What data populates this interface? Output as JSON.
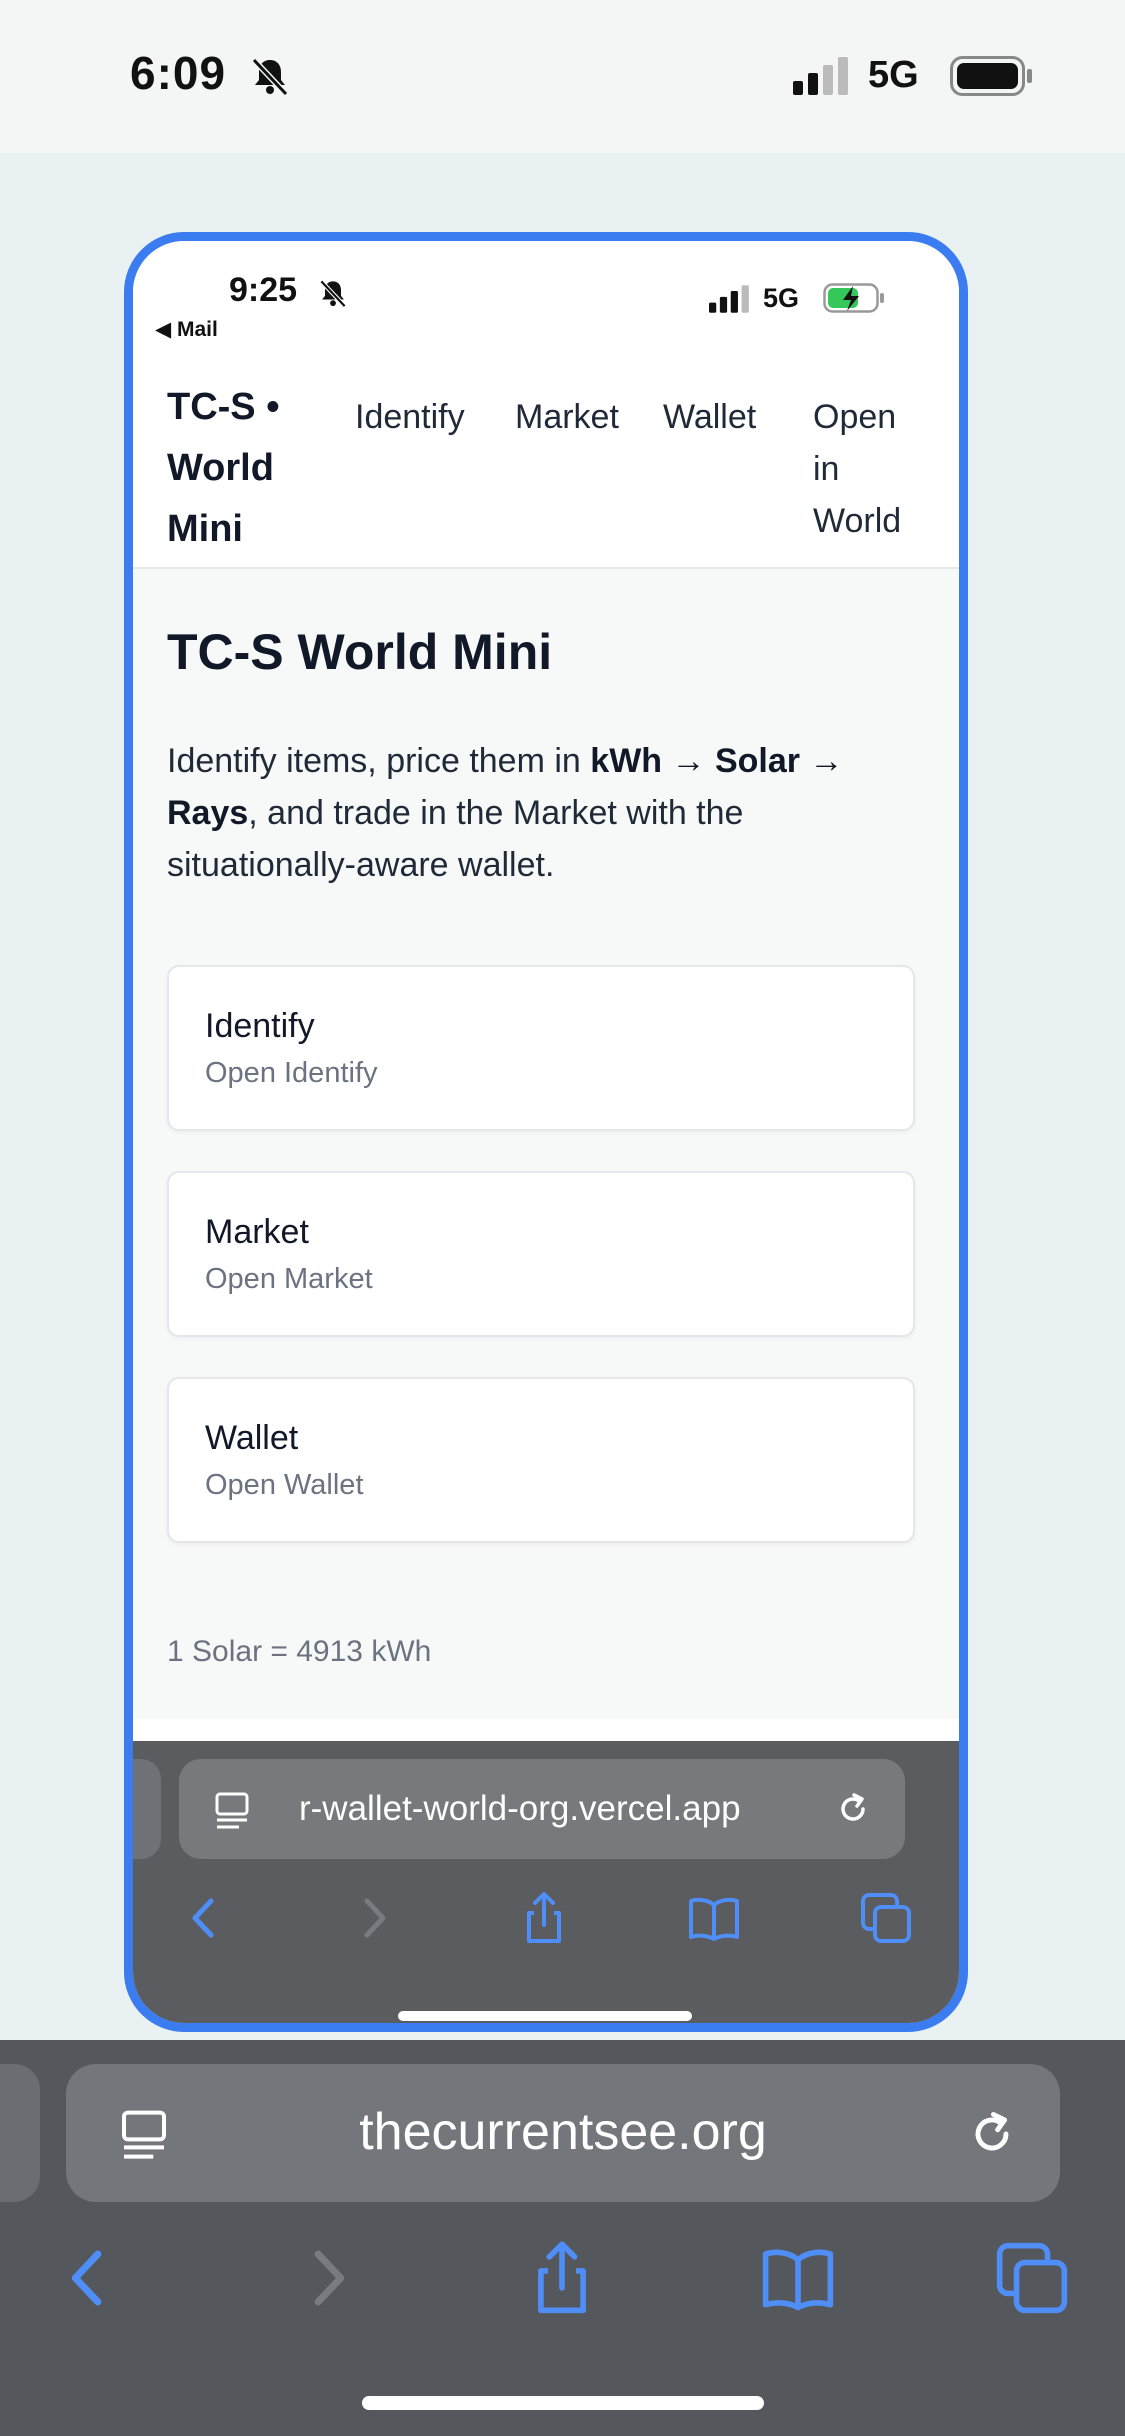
{
  "outer_status": {
    "time": "6:09",
    "network": "5G"
  },
  "inner_status": {
    "time": "9:25",
    "back_label": "◀ Mail",
    "network": "5G"
  },
  "nav": {
    "brand": "TC-S • World Mini",
    "links": [
      "Identify",
      "Market",
      "Wallet",
      "Open in World"
    ]
  },
  "main": {
    "title": "TC-S World Mini",
    "intro_prefix": "Identify items, price them in ",
    "intro_bold": "kWh → Solar → Rays",
    "intro_suffix": ", and trade in the Market with the situationally-aware wallet.",
    "cards": [
      {
        "title": "Identify",
        "subtitle": "Open Identify"
      },
      {
        "title": "Market",
        "subtitle": "Open Market"
      },
      {
        "title": "Wallet",
        "subtitle": "Open Wallet"
      }
    ],
    "rate_text": "1 Solar = 4913 kWh"
  },
  "inner_browser": {
    "url": "r-wallet-world-org.vercel.app"
  },
  "outer_browser": {
    "url": "thecurrentsee.org"
  },
  "colors": {
    "accent": "#3b7df0",
    "browser_icon": "#4f8ef7",
    "page_bg": "#eaf1f2",
    "toolbar_bg": "#54575b"
  },
  "icons": [
    "bell-slash-icon",
    "signal-icon",
    "battery-icon",
    "battery-charging-icon",
    "reader-icon",
    "reload-icon",
    "back-arrow-icon",
    "forward-arrow-icon",
    "share-icon",
    "bookmarks-icon",
    "tabs-icon"
  ]
}
